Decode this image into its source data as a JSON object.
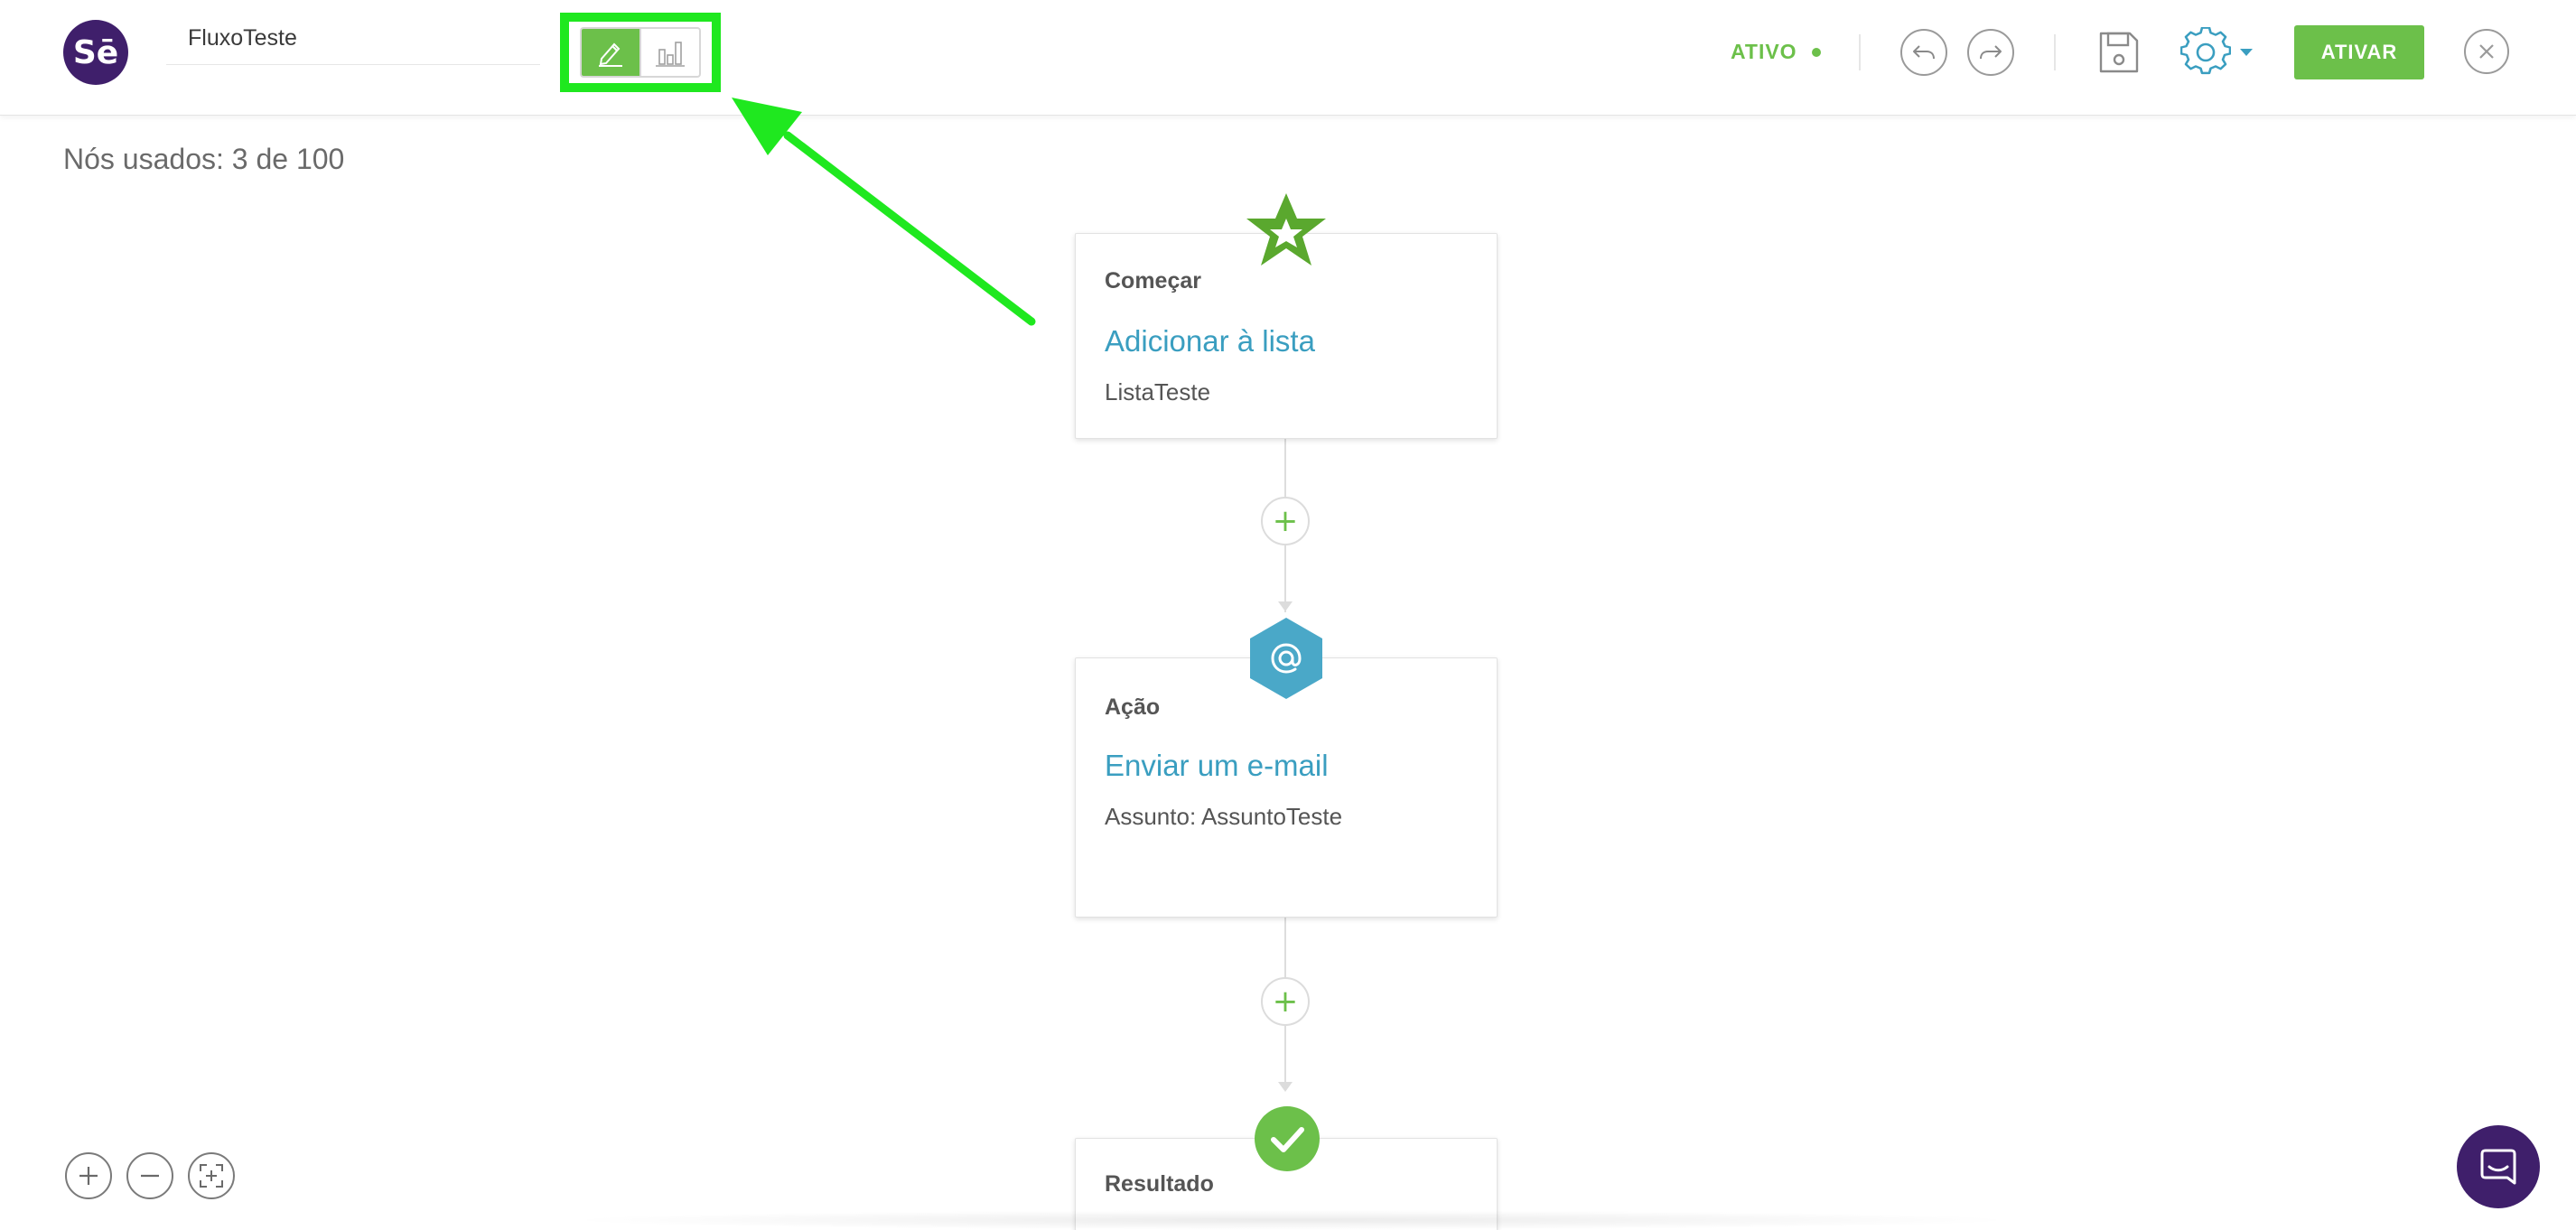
{
  "header": {
    "logo_text": "Sē",
    "flow_name": "FluxoTeste",
    "mode_toggle": {
      "edit_icon": "pencil-icon",
      "reports_icon": "bar-chart-icon",
      "active": "edit"
    },
    "status_label": "ATIVO",
    "undo_icon": "undo-icon",
    "redo_icon": "redo-icon",
    "save_icon": "save-icon",
    "settings_icon": "gear-icon",
    "activate_label": "ATIVAR",
    "close_icon": "close-icon"
  },
  "nodes_used": "Nós usados: 3 de 100",
  "flow": {
    "start": {
      "kind": "Começar",
      "title": "Adicionar à lista",
      "subtitle": "ListaTeste",
      "icon": "star-icon"
    },
    "action": {
      "kind": "Ação",
      "title": "Enviar um e-mail",
      "subtitle": "Assunto: AssuntoTeste",
      "icon": "at-sign-icon"
    },
    "result": {
      "kind": "Resultado",
      "icon": "check-icon"
    },
    "add_step_label": "+"
  },
  "colors": {
    "brand_purple": "#3f1f6b",
    "accent_green": "#6cc04a",
    "link_blue": "#3a9ec0",
    "highlight_green": "#1fe81f",
    "hex_blue": "#4aa8c8"
  }
}
